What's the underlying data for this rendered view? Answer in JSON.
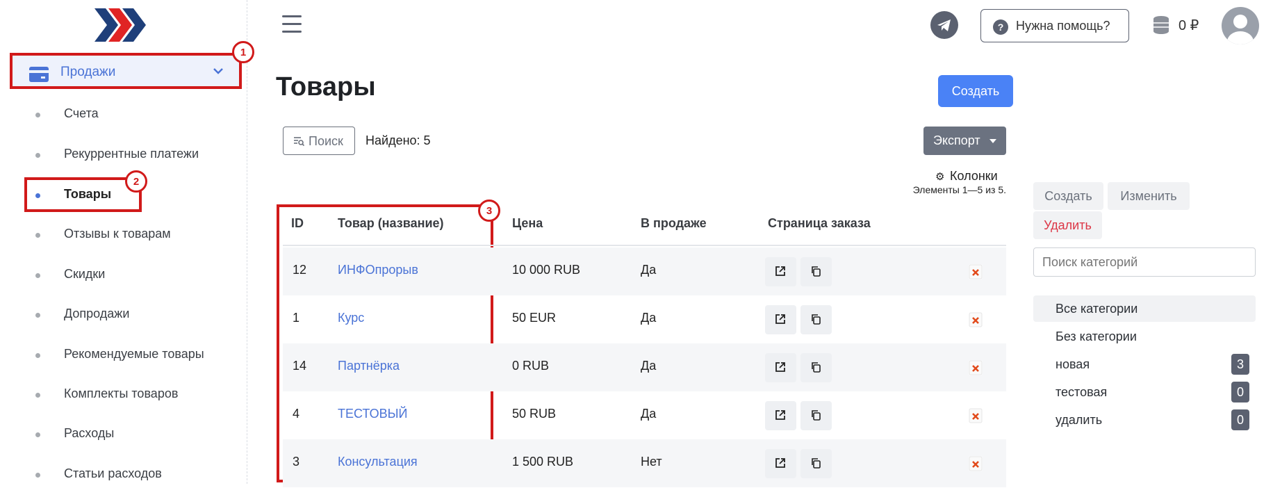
{
  "sidebar": {
    "section": {
      "label": "Продажи",
      "icon": "credit-card-icon"
    },
    "items": [
      {
        "label": "Счета",
        "active": false
      },
      {
        "label": "Рекуррентные платежи",
        "active": false
      },
      {
        "label": "Товары",
        "active": true
      },
      {
        "label": "Отзывы к товарам",
        "active": false
      },
      {
        "label": "Скидки",
        "active": false
      },
      {
        "label": "Допродажи",
        "active": false
      },
      {
        "label": "Рекомендуемые товары",
        "active": false
      },
      {
        "label": "Комплекты товаров",
        "active": false
      },
      {
        "label": "Расходы",
        "active": false
      },
      {
        "label": "Статьи расходов",
        "active": false
      }
    ]
  },
  "annotations": [
    "1",
    "2",
    "3"
  ],
  "header": {
    "help_label": "Нужна помощь?",
    "help_icon_text": "?",
    "balance": "0 ₽"
  },
  "main": {
    "title": "Товары",
    "create_label": "Создать",
    "search_label": "Поиск",
    "found_text": "Найдено: 5",
    "export_label": "Экспорт",
    "columns_label": "Колонки",
    "elements_text": "Элементы 1—5 из 5."
  },
  "table": {
    "headers": {
      "id": "ID",
      "name": "Товар (название)",
      "price": "Цена",
      "on_sale": "В продаже",
      "order_page": "Страница заказа"
    },
    "rows": [
      {
        "id": "12",
        "name": "ИНФОпрорыв",
        "price": "10 000 RUB",
        "on_sale": "Да"
      },
      {
        "id": "1",
        "name": "Курс",
        "price": "50 EUR",
        "on_sale": "Да"
      },
      {
        "id": "14",
        "name": "Партнёрка",
        "price": "0 RUB",
        "on_sale": "Да"
      },
      {
        "id": "4",
        "name": "ТЕСТОВЫЙ",
        "price": "50 RUB",
        "on_sale": "Да"
      },
      {
        "id": "3",
        "name": "Консультация",
        "price": "1 500 RUB",
        "on_sale": "Нет"
      }
    ]
  },
  "categories_panel": {
    "create_label": "Создать",
    "edit_label": "Изменить",
    "delete_label": "Удалить",
    "search_placeholder": "Поиск категорий",
    "items": [
      {
        "label": "Все категории",
        "count": null,
        "active": true
      },
      {
        "label": "Без категории",
        "count": null,
        "active": false
      },
      {
        "label": "новая",
        "count": "3",
        "active": false
      },
      {
        "label": "тестовая",
        "count": "0",
        "active": false
      },
      {
        "label": "удалить",
        "count": "0",
        "active": false
      }
    ]
  },
  "colors": {
    "accent": "#4a82f6",
    "link": "#4a73d6",
    "annotation": "#d11a1a",
    "secondary": "#6b7280"
  }
}
